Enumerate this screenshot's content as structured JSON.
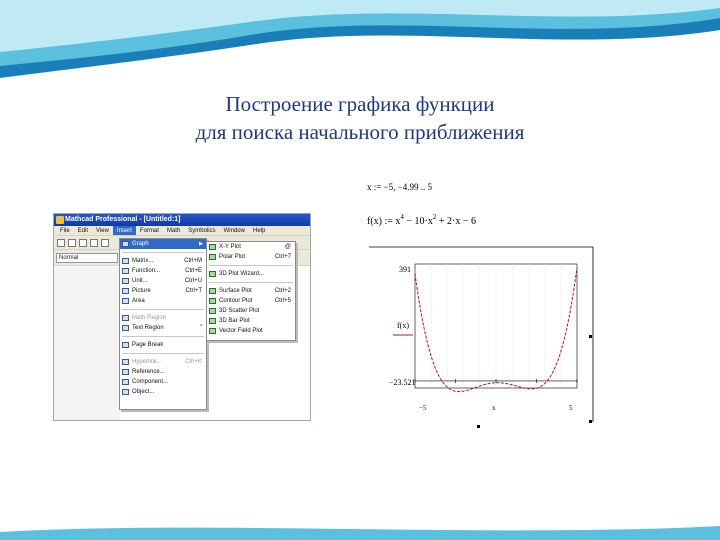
{
  "slide": {
    "title_line1": "Построение графика функции",
    "title_line2": "для поиска начального приближения",
    "title_color": "#1f3a7a",
    "wave_colors": [
      "#5bc0de",
      "#1a7fb8"
    ]
  },
  "mathcad": {
    "window_title": "Mathcad Professional - [Untitled:1]",
    "menubar": [
      "File",
      "Edit",
      "View",
      "Insert",
      "Format",
      "Math",
      "Symbolics",
      "Window",
      "Help"
    ],
    "active_menu": "Insert",
    "style_select": "Normal",
    "insert_menu": [
      {
        "label": "Graph",
        "key": "",
        "submenu": true,
        "highlight": true
      },
      {
        "sep": true
      },
      {
        "label": "Matrix...",
        "key": "Ctrl+M"
      },
      {
        "label": "Function...",
        "key": "Ctrl+E"
      },
      {
        "label": "Unit...",
        "key": "Ctrl+U"
      },
      {
        "label": "Picture",
        "key": "Ctrl+T"
      },
      {
        "label": "Area",
        "key": ""
      },
      {
        "sep": true
      },
      {
        "label": "Math Region",
        "key": "",
        "disabled": true
      },
      {
        "label": "Text Region",
        "key": "\""
      },
      {
        "sep": true
      },
      {
        "label": "Page Break",
        "key": ""
      },
      {
        "sep": true
      },
      {
        "label": "Hyperlink...",
        "key": "Ctrl+K",
        "disabled": true
      },
      {
        "label": "Reference...",
        "key": ""
      },
      {
        "label": "Component...",
        "key": ""
      },
      {
        "label": "Object...",
        "key": ""
      }
    ],
    "graph_submenu": [
      {
        "label": "X-Y Plot",
        "key": "@"
      },
      {
        "label": "Polar Plot",
        "key": "Ctrl+7"
      },
      {
        "sep": true
      },
      {
        "label": "3D Plot Wizard...",
        "key": ""
      },
      {
        "sep": true
      },
      {
        "label": "Surface Plot",
        "key": "Ctrl+2"
      },
      {
        "label": "Contour Plot",
        "key": "Ctrl+5"
      },
      {
        "label": "3D Scatter Plot",
        "key": ""
      },
      {
        "label": "3D Bar Plot",
        "key": ""
      },
      {
        "label": "Vector Field Plot",
        "key": ""
      }
    ],
    "selection_color": "#316ac5"
  },
  "plot": {
    "range_def": "x := −5, −4.99 .. 5",
    "function_def_left": "f(x) := x",
    "function_def_pow4": "4",
    "function_def_mid": " − 10·x",
    "function_def_pow2": "2",
    "function_def_right": " + 2·x − 6",
    "ytick_top": "391",
    "ytick_bottom": "−23.521",
    "legend_label": "f(x)",
    "xtick_left": "−5",
    "xtick_right": "5",
    "xaxis_label": "x",
    "curve_color": "#b01818",
    "chart_data": {
      "type": "line",
      "series": [
        {
          "name": "f(x)",
          "expr": "x^4 - 10x^2 + 2x - 6"
        }
      ],
      "xlim": [
        -5,
        5
      ],
      "ylim": [
        -23.521,
        391
      ],
      "xlabel": "x",
      "ylabel": "f(x)"
    }
  }
}
